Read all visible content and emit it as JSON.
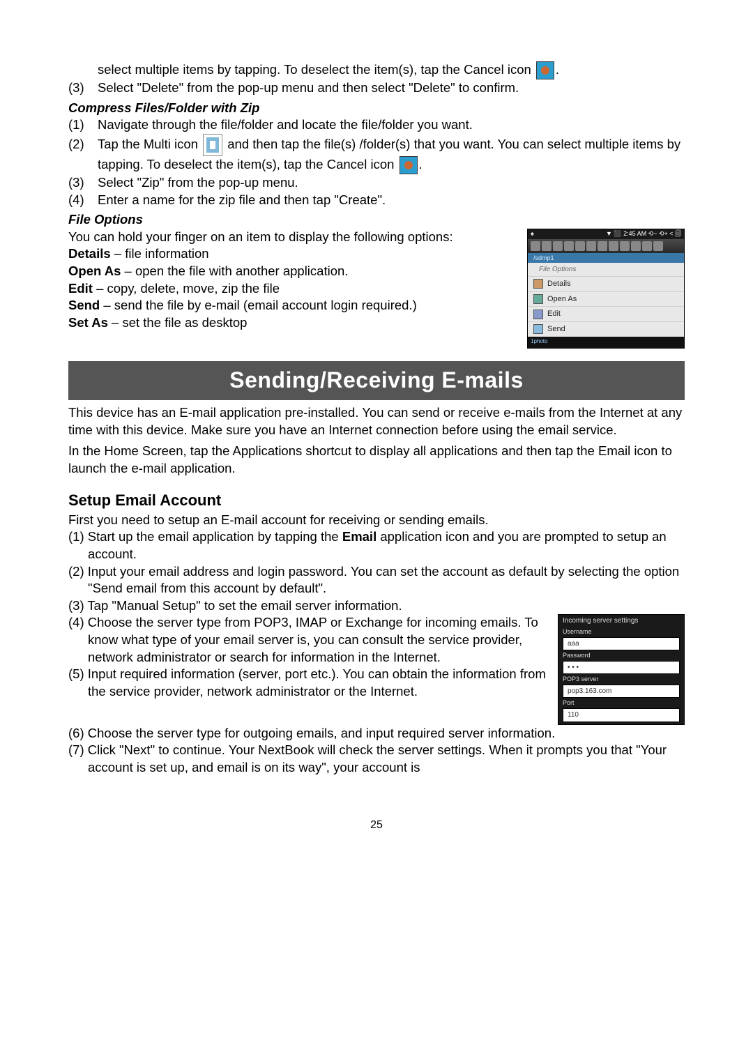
{
  "top_continued": {
    "line1_prefix": "select multiple items by tapping. To deselect the item(s), tap the Cancel icon",
    "line1_suffix": ".",
    "item3": "Select \"Delete\" from the pop-up menu and then select \"Delete\" to confirm."
  },
  "compress": {
    "heading": "Compress Files/Folder with Zip",
    "item1": "Navigate through the file/folder and locate the file/folder you want.",
    "item2a": "Tap the Multi icon",
    "item2b": " and then tap the file(s) /folder(s) that you want. You can select multiple items by tapping. To deselect the item(s), tap the Cancel icon",
    "item2c": ".",
    "item3": "Select \"Zip\" from the pop-up menu.",
    "item4": "Enter a name for the zip file and then tap \"Create\"."
  },
  "file_options": {
    "heading": "File Options",
    "intro": "You can hold your finger on an item to display the following options:",
    "details_label": "Details",
    "details_desc": " – file information",
    "open_label": "Open As",
    "open_desc": " – open the file with another application.",
    "edit_label": "Edit",
    "edit_desc": " – copy, delete, move, zip the file",
    "send_label": "Send",
    "send_desc": " – send the file by e-mail (email account login required.)",
    "set_label": "Set As",
    "set_desc": " – set the file as desktop"
  },
  "file_options_fig": {
    "status_left": "♠",
    "status_right": "▼ ⬛ 2:45 AM   ⟲−   ⟲+   <   🗐",
    "path": "/sdmp1",
    "menu_title": "File Options",
    "items": [
      "Details",
      "Open As",
      "Edit",
      "Send"
    ],
    "footer_left": "1photo"
  },
  "banner": "Sending/Receiving E-mails",
  "email_intro1": "This device has an E-mail application pre-installed. You can send or receive e-mails from the Internet at any time with this device. Make sure you have an Internet connection before using the email service.",
  "email_intro2": "In the Home Screen, tap the Applications shortcut to display all applications and then tap the Email icon to launch the e-mail application.",
  "setup": {
    "heading": "Setup Email Account",
    "intro": "First you need to setup an E-mail account for receiving or sending emails.",
    "item1a": "(1) Start up the email application by tapping the ",
    "item1_email": "Email",
    "item1b": " application icon and you are prompted to setup an account.",
    "item2": "(2) Input your email address and login password. You can set the account as default by selecting the option \"Send email from this account by default\".",
    "item3": "(3) Tap \"Manual Setup\" to set the email server information.",
    "item4": "(4) Choose the server type from POP3, IMAP or Exchange for incoming emails. To know what type of your email server is, you can consult the service provider, network administrator or search for information in the Internet.",
    "item5": "(5) Input required information (server, port etc.). You can obtain the information from the service provider, network administrator or the Internet.",
    "item6": "(6) Choose the server type for outgoing emails, and input required server information.",
    "item7": "(7) Click \"Next\" to continue. Your NextBook will check the server settings. When it prompts you that \"Your account is set up, and email is on its way\", your account is"
  },
  "server_fig": {
    "title": "Incoming server settings",
    "username_label": "Username",
    "username_val": "aaa",
    "password_label": "Password",
    "password_val": "• • •",
    "pop_label": "POP3 server",
    "pop_val": "pop3.163.com",
    "port_label": "Port",
    "port_val": "110"
  },
  "page_number": "25",
  "nums": {
    "n1": "(1)",
    "n2": "(2)",
    "n3": "(3)",
    "n4": "(4)"
  }
}
